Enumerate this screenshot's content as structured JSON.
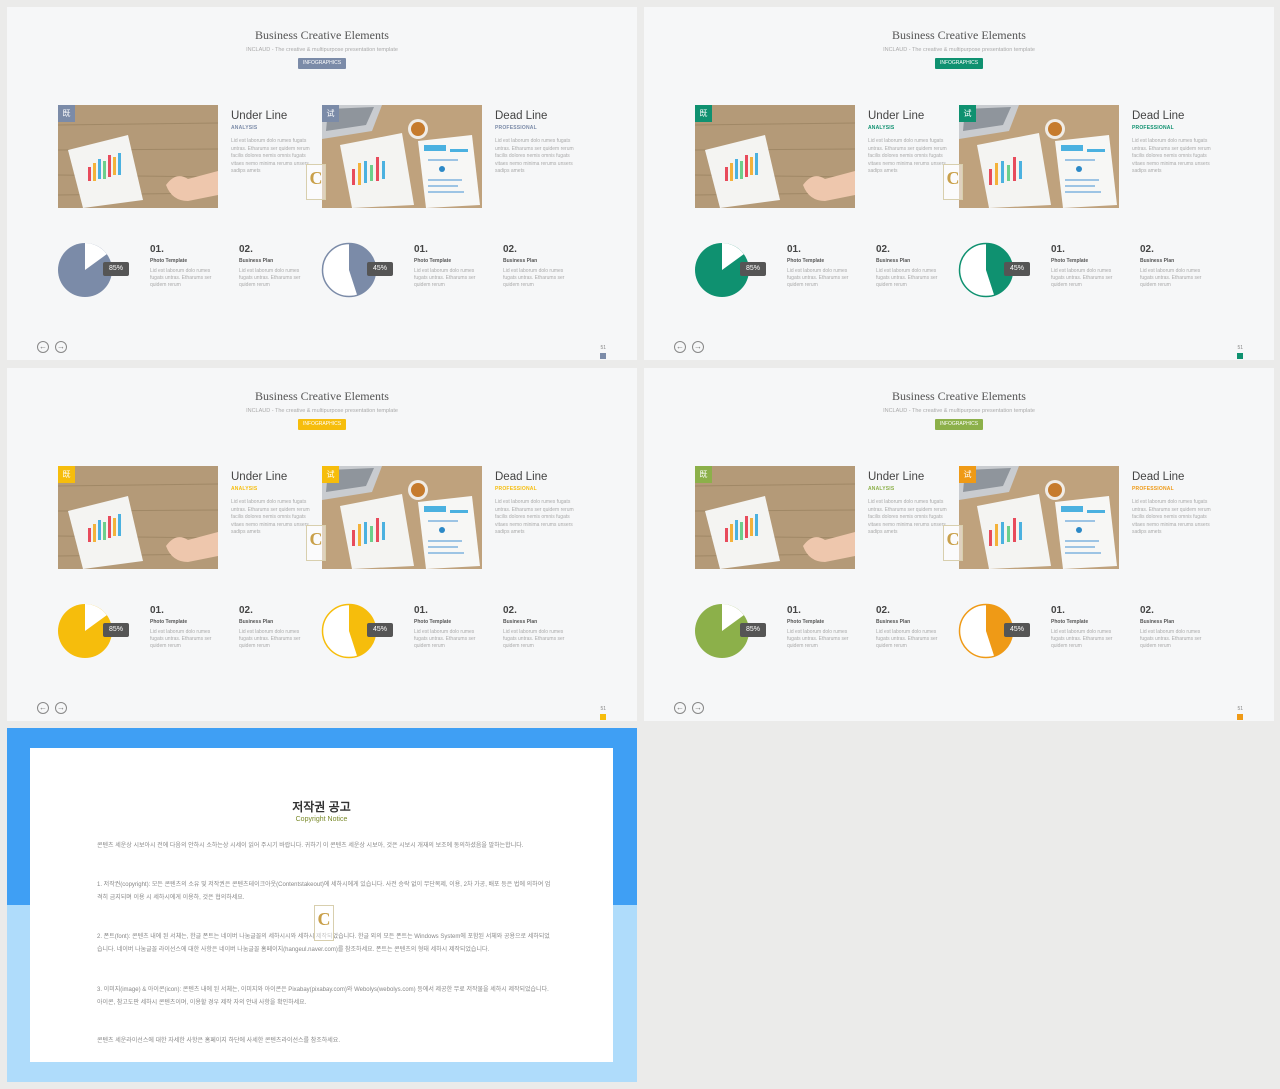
{
  "slide": {
    "title": "Business Creative Elements",
    "subtitle": "INCLAUD - The creative & multipurpose presentation template",
    "badge": "INFOGRAPHICS",
    "card1": {
      "tag": "既",
      "heading": "Under Line",
      "sub": "ANALYSIS"
    },
    "card2": {
      "tag": "试",
      "heading": "Dead Line",
      "sub": "PROFESSIONAL"
    },
    "body_text": "Lid est laborum dolo rumes fugats untras. Etharums ser quidem rerum facilis dolores nemis omnis fugats vitaes nemo minima rerums unsers sadips amets",
    "pie1_label": "85%",
    "pie2_label": "45%",
    "item1": {
      "num": "01.",
      "label": "Photo Template"
    },
    "item2": {
      "num": "02.",
      "label": "Business Plan"
    },
    "item_text": "Lid est laborum dolo rumes fugats untras. Etharums ser quidem rerum",
    "page": "51",
    "watermark": "C",
    "nav_prev": "←",
    "nav_next": "→"
  },
  "themes": [
    {
      "accent": "#7b8ba8",
      "accent2": "#7b8ba8"
    },
    {
      "accent": "#0f9170",
      "accent2": "#0f9170"
    },
    {
      "accent": "#f6bd0c",
      "accent2": "#f6bd0c"
    },
    {
      "accent": "#8cb04a",
      "accent2": "#ef9a16"
    }
  ],
  "copyright": {
    "title": "저작권 공고",
    "subtitle": "Copyright Notice",
    "p1": "콘텐츠 세운상 시보아시 전에 다음의 안하시 소하는상 시세이 읽어 주시기 바랍니다. 귀하기 이 콘텐츠 세운상 시보아, 것은 시보시 개재의 보조에 동의하셨음을 말하는합니다.",
    "p2": "1. 저작권(copyright): 모든 콘텐츠의 소유 및 저작권은 콘텐츠테이크아웃(Contentstakeout)에 세하시에게 있습니다. 사전 승락 없이 무단복제, 이용, 2차 가공, 배포 등은 법에 의하여 엄격히 금지되며 이용 시 세하시에게 이용하, 것은 협의하세요.",
    "p3": "2. 폰트(font): 콘텐츠 내에 된 서체는, 한글 폰트는 네이버 나눔글꼴의 세하시시와 세하시 제작되었습니다. 한글 외의 모든 폰트는 Windows System에 포함된 서체와 공용으로 세하되었습니다. 네이버 나눔글꼴 라이선스에 대한 사항은 네이버 나눔글꼴 홈페이지(hangeul.naver.com)를 참조하세요. 폰트는 콘텐츠의 형태 세하시 제작되었습니다.",
    "p4": "3. 이미지(image) & 아이콘(icon): 콘텐츠 내에 된 서체는, 이미지와 아이콘은 Pixabay(pixabay.com)와 Webolys(webolys.com) 등에서 제공한 무료 저작물을 세하시 제작되었습니다. 아이콘, 참고도판 세하시 콘텐츠이며, 이용할 경우 제작 자의 안내 사항을 확인하세요.",
    "p5": "콘텐츠 세운라이선스에 대한 자세한 사항은 홈페이지 하단에 사세한 콘텐츠라이선스를 참조하세요.",
    "watermark": "C"
  }
}
